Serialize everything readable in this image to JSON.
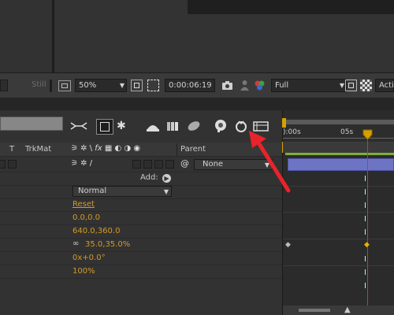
{
  "viewer": {
    "still_label": "Still",
    "zoom": "50%",
    "timecode": "0:00:06:19",
    "resolution": "Full",
    "active_camera": "Acti"
  },
  "timeline": {
    "col_t": "T",
    "col_trkmat": "TrkMat",
    "col_parent": "Parent",
    "parent_value": "None",
    "add_label": "Add:",
    "blend_mode": "Normal",
    "ruler_start": "):00s",
    "ruler_mark": "05s"
  },
  "properties": [
    {
      "value": "Reset"
    },
    {
      "value": "0.0,0.0"
    },
    {
      "value": "640.0,360.0"
    },
    {
      "value": "35.0,35.0%"
    },
    {
      "value": "0x+0.0°"
    },
    {
      "value": "100%"
    }
  ],
  "annotation": {
    "arrow_color": "#e8232b"
  }
}
